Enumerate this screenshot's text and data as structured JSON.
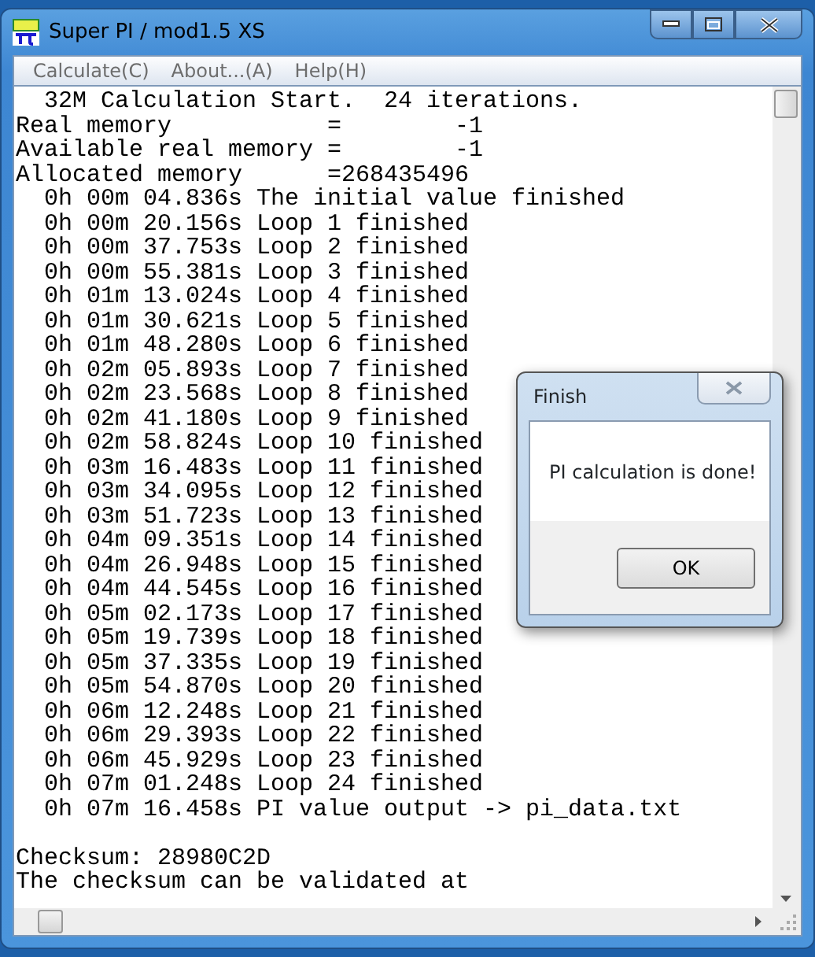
{
  "window": {
    "title": "Super PI / mod1.5 XS"
  },
  "menu": [
    {
      "label": "Calculate(C)",
      "disabled": true
    },
    {
      "label": "About...(A)",
      "disabled": true
    },
    {
      "label": "Help(H)",
      "disabled": true
    }
  ],
  "output": {
    "lines": [
      "  32M Calculation Start.  24 iterations.",
      "Real memory           =        -1",
      "Available real memory =        -1",
      "Allocated memory      =268435496",
      "  0h 00m 04.836s The initial value finished",
      "  0h 00m 20.156s Loop 1 finished",
      "  0h 00m 37.753s Loop 2 finished",
      "  0h 00m 55.381s Loop 3 finished",
      "  0h 01m 13.024s Loop 4 finished",
      "  0h 01m 30.621s Loop 5 finished",
      "  0h 01m 48.280s Loop 6 finished",
      "  0h 02m 05.893s Loop 7 finished",
      "  0h 02m 23.568s Loop 8 finished",
      "  0h 02m 41.180s Loop 9 finished",
      "  0h 02m 58.824s Loop 10 finished",
      "  0h 03m 16.483s Loop 11 finished",
      "  0h 03m 34.095s Loop 12 finished",
      "  0h 03m 51.723s Loop 13 finished",
      "  0h 04m 09.351s Loop 14 finished",
      "  0h 04m 26.948s Loop 15 finished",
      "  0h 04m 44.545s Loop 16 finished",
      "  0h 05m 02.173s Loop 17 finished",
      "  0h 05m 19.739s Loop 18 finished",
      "  0h 05m 37.335s Loop 19 finished",
      "  0h 05m 54.870s Loop 20 finished",
      "  0h 06m 12.248s Loop 21 finished",
      "  0h 06m 29.393s Loop 22 finished",
      "  0h 06m 45.929s Loop 23 finished",
      "  0h 07m 01.248s Loop 24 finished",
      "  0h 07m 16.458s PI value output -> pi_data.txt"
    ],
    "footer_lines": [
      "Checksum: 28980C2D",
      "The checksum can be validated at"
    ]
  },
  "dialog": {
    "title": "Finish",
    "message": "PI calculation is done!",
    "button": "OK"
  }
}
